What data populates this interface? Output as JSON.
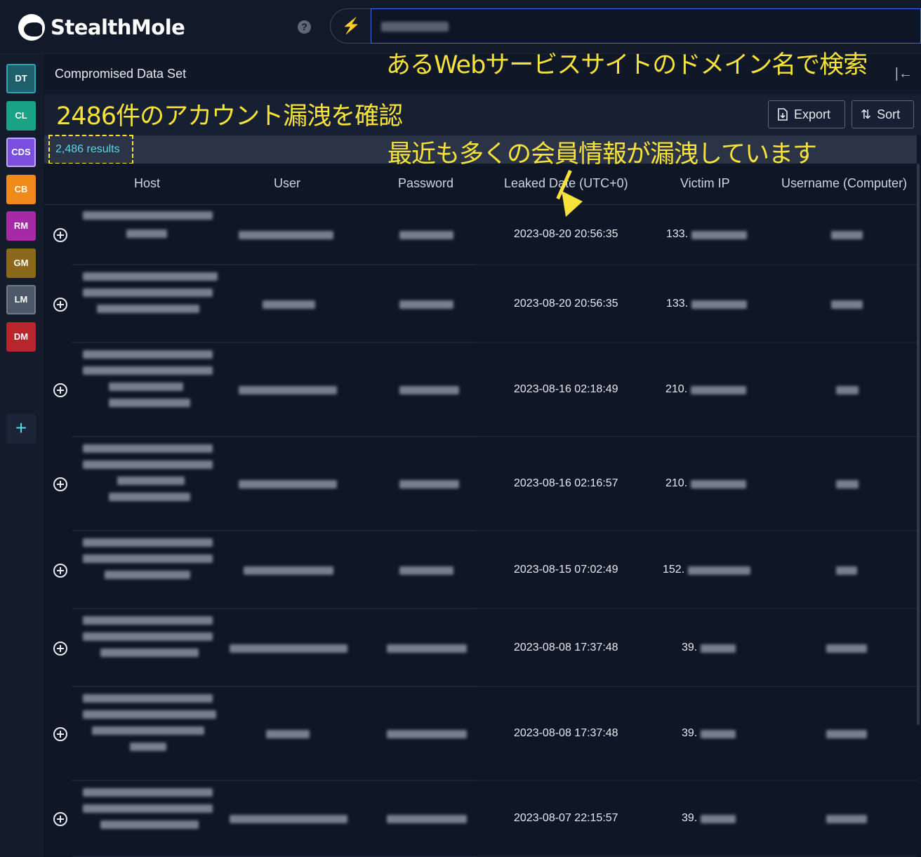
{
  "brand": {
    "name": "StealthMole"
  },
  "topbar": {
    "help_label": "?"
  },
  "sidebar": {
    "items": [
      {
        "code": "DT",
        "bg": "#1d5f6b",
        "border": "#2aa6b6"
      },
      {
        "code": "CL",
        "bg": "#1aa384",
        "border": "#1aa384"
      },
      {
        "code": "CDS",
        "bg": "#7a4fe0",
        "border": "#c2a9ff"
      },
      {
        "code": "CB",
        "bg": "#f08a1c",
        "border": "#f08a1c"
      },
      {
        "code": "RM",
        "bg": "#a62aa6",
        "border": "#a62aa6"
      },
      {
        "code": "GM",
        "bg": "#8a6a1a",
        "border": "#8a6a1a"
      },
      {
        "code": "LM",
        "bg": "#4d5868",
        "border": "#6f7a8a"
      },
      {
        "code": "DM",
        "bg": "#b8262d",
        "border": "#b8262d"
      }
    ],
    "add_label": "+"
  },
  "panel": {
    "title": "Compromised Data Set",
    "collapse_label": "|←",
    "export_label": "Export",
    "sort_label": "Sort",
    "results": "2,486 results"
  },
  "columns": {
    "host": "Host",
    "user": "User",
    "password": "Password",
    "leaked_date": "Leaked Date (UTC+0)",
    "victim_ip": "Victim IP",
    "username": "Username (Computer)"
  },
  "rows": [
    {
      "leaked_date": "2023-08-20 20:56:35",
      "ip_prefix": "133."
    },
    {
      "leaked_date": "2023-08-20 20:56:35",
      "ip_prefix": "133."
    },
    {
      "leaked_date": "2023-08-16 02:18:49",
      "ip_prefix": "210."
    },
    {
      "leaked_date": "2023-08-16 02:16:57",
      "ip_prefix": "210."
    },
    {
      "leaked_date": "2023-08-15 07:02:49",
      "ip_prefix": "152."
    },
    {
      "leaked_date": "2023-08-08 17:37:48",
      "ip_prefix": "39."
    },
    {
      "leaked_date": "2023-08-08 17:37:48",
      "ip_prefix": "39."
    },
    {
      "leaked_date": "2023-08-07 22:15:57",
      "ip_prefix": "39."
    }
  ],
  "annotations": {
    "search_note": "あるWebサービスサイトのドメイン名で検索",
    "count_note": "2486件のアカウント漏洩を確認",
    "recent_note": "最近も多くの会員情報が漏洩しています"
  },
  "colors": {
    "annotation": "#f6e23a",
    "accent": "#5fd3e8",
    "search_border": "#3b6de0"
  }
}
